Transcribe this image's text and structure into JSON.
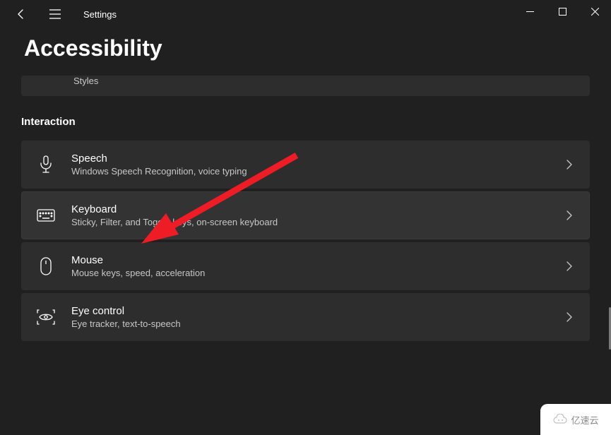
{
  "window": {
    "app_title": "Settings"
  },
  "page": {
    "title": "Accessibility"
  },
  "partial_card": {
    "subtitle": "Styles"
  },
  "section": {
    "label": "Interaction"
  },
  "items": [
    {
      "title": "Speech",
      "subtitle": "Windows Speech Recognition, voice typing"
    },
    {
      "title": "Keyboard",
      "subtitle": "Sticky, Filter, and Toggle keys, on-screen keyboard"
    },
    {
      "title": "Mouse",
      "subtitle": "Mouse keys, speed, acceleration"
    },
    {
      "title": "Eye control",
      "subtitle": "Eye tracker, text-to-speech"
    }
  ],
  "annotation": {
    "arrow_color": "#ee1c25",
    "target": "Keyboard"
  },
  "watermark": {
    "text": "亿速云"
  }
}
